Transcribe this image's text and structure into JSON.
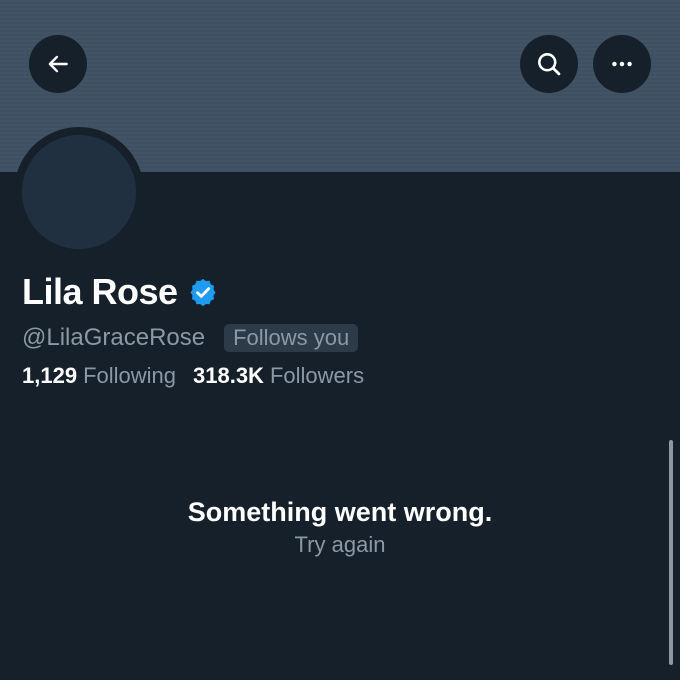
{
  "profile": {
    "display_name": "Lila Rose",
    "verified": true,
    "handle": "@LilaGraceRose",
    "follows_you": "Follows you"
  },
  "stats": {
    "following_count": "1,129",
    "following_label": "Following",
    "followers_count": "318.3K",
    "followers_label": "Followers"
  },
  "error": {
    "title": "Something went wrong.",
    "retry_label": "Try again"
  },
  "icons": {
    "back": "arrow-left-icon",
    "search": "search-icon",
    "more": "more-horizontal-icon",
    "verified": "verified-badge-icon"
  },
  "colors": {
    "background": "#16202b",
    "banner": "#425366",
    "secondary_text": "#8b98a5",
    "verified_blue": "#1d9bf0"
  }
}
